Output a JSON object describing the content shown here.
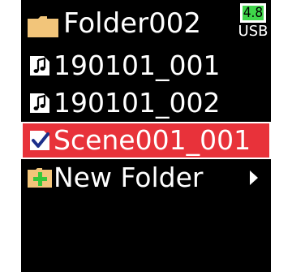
{
  "header": {
    "title": "Folder002",
    "folder_icon": "folder-icon"
  },
  "status": {
    "battery_level": "4.8",
    "power_source": "USB",
    "battery_color": "#3fd64a"
  },
  "list": {
    "items": [
      {
        "label": "190101_001",
        "icon": "audio-file-icon"
      },
      {
        "label": "190101_002",
        "icon": "audio-file-icon"
      },
      {
        "label": "Scene001_001",
        "icon": "checked-file-icon",
        "selected": true
      },
      {
        "label": "New Folder",
        "icon": "new-folder-icon",
        "has_submenu": true
      }
    ]
  },
  "colors": {
    "selection": "#e8323a",
    "folder": "#f2c57a",
    "new_folder_plus": "#35c83b"
  }
}
